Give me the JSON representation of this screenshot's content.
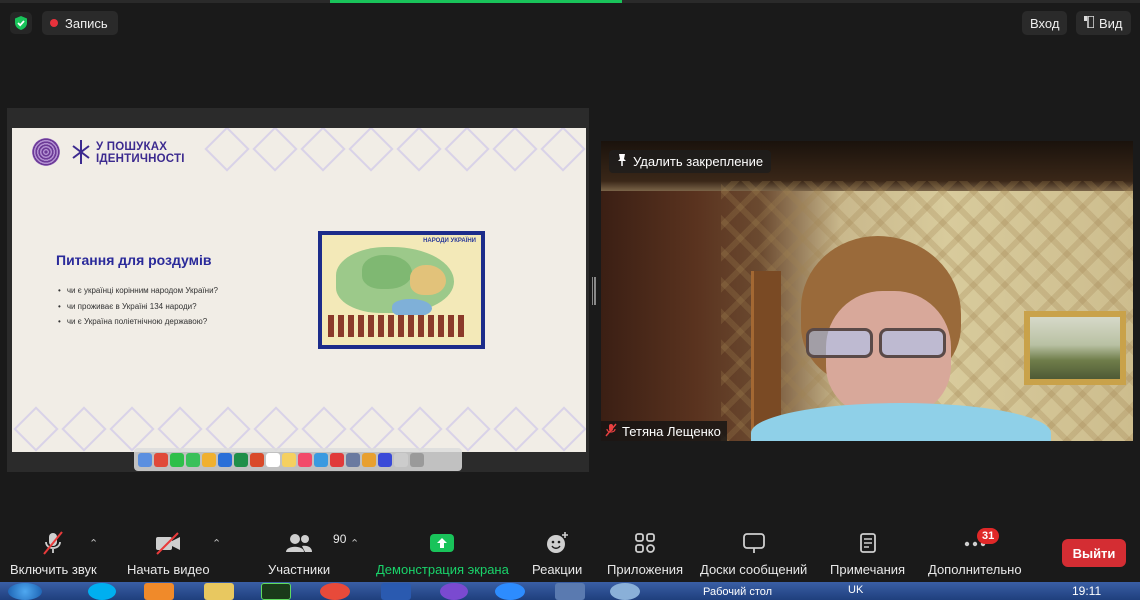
{
  "top_bar": {
    "record_label": "Запись",
    "signin_label": "Вход",
    "view_label": "Вид"
  },
  "slide": {
    "logo_line1": "У ПОШУКАХ",
    "logo_line2": "ІДЕНТИЧНОСТІ",
    "title": "Питання для роздумів",
    "bullets": [
      "чи є українці корінним народом України?",
      "чи проживає в Україні 134 народи?",
      "чи є Україна поліетнічною державою?"
    ],
    "map_title": "НАРОДИ УКРАЇНИ"
  },
  "video": {
    "unpin_label": "Удалить закрепление",
    "participant_name": "Тетяна Лещенко"
  },
  "toolbar": {
    "mute_label": "Включить звук",
    "video_label": "Начать видео",
    "participants_label": "Участники",
    "participants_count": "90",
    "share_label": "Демонстрация экрана",
    "reactions_label": "Реакции",
    "apps_label": "Приложения",
    "whiteboards_label": "Доски сообщений",
    "notes_label": "Примечания",
    "more_label": "Дополнительно",
    "more_badge": "31",
    "end_label": "Выйти"
  },
  "taskbar": {
    "desktop_label": "Рабочий стол",
    "lang": "UK",
    "time": "19:11"
  },
  "colors": {
    "accent_green": "#19c35a",
    "end_red": "#d42d33",
    "slide_title": "#2a2a9a"
  }
}
